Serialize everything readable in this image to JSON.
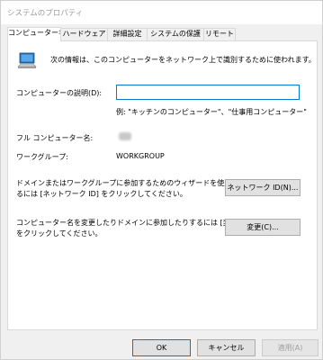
{
  "window": {
    "title": "システムのプロパティ"
  },
  "tabs": [
    {
      "label": "コンピューター名",
      "active": true
    },
    {
      "label": "ハードウェア",
      "active": false
    },
    {
      "label": "詳細設定",
      "active": false
    },
    {
      "label": "システムの保護",
      "active": false
    },
    {
      "label": "リモート",
      "active": false
    }
  ],
  "panel": {
    "intro_text": "次の情報は、このコンピューターをネットワーク上で識別するために使われます。",
    "description_label": "コンピューターの説明(D):",
    "description_value": "",
    "example_text": "例: \"キッチンのコンピューター\"、\"仕事用コンピューター\"",
    "full_name_label": "フル コンピューター名:",
    "workgroup_label": "ワークグループ:",
    "workgroup_value": "WORKGROUP",
    "network_id_text_line1": "ドメインまたはワークグループに参加するためのウィザードを使用す",
    "network_id_text_line2": "るには [ネットワーク ID] をクリックしてください。",
    "network_id_button": "ネットワーク ID(N)...",
    "change_text_line1": "コンピューター名を変更したりドメインに参加したりするには [変更]",
    "change_text_line2": "をクリックしてください。",
    "change_button": "変更(C)..."
  },
  "footer": {
    "ok_button": "OK",
    "cancel_button": "キャンセル",
    "apply_button": "適用(A)"
  },
  "icons": {
    "computer": "computer-monitor-icon"
  }
}
